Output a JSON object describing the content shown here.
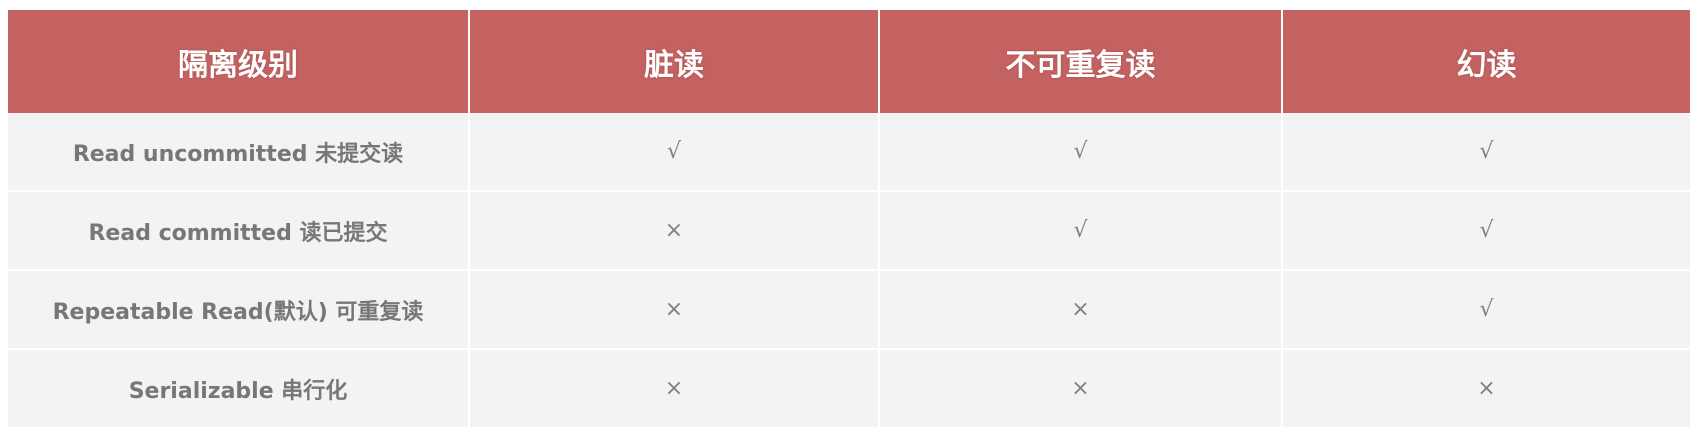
{
  "table": {
    "headers": [
      "隔离级别",
      "脏读",
      "不可重复读",
      "幻读"
    ],
    "rows": [
      {
        "level": "Read uncommitted 未提交读",
        "dirty_read": "√",
        "non_repeatable_read": "√",
        "phantom_read": "√"
      },
      {
        "level": "Read committed 读已提交",
        "dirty_read": "×",
        "non_repeatable_read": "√",
        "phantom_read": "√"
      },
      {
        "level": "Repeatable Read(默认) 可重复读",
        "dirty_read": "×",
        "non_repeatable_read": "×",
        "phantom_read": "√"
      },
      {
        "level": "Serializable 串行化",
        "dirty_read": "×",
        "non_repeatable_read": "×",
        "phantom_read": "×"
      }
    ]
  },
  "colors": {
    "header_bg": "#c46262",
    "header_text": "#ffffff",
    "cell_bg": "#f3f3f3",
    "cell_text": "#777777"
  }
}
